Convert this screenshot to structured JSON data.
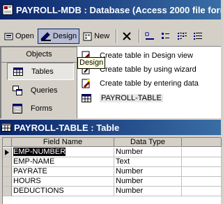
{
  "db_window": {
    "title": "PAYROLL-MDB : Database (Access 2000 file form",
    "toolbar": {
      "open": "Open",
      "design": "Design",
      "new": "New"
    },
    "objects_header": "Objects",
    "objects": [
      "Tables",
      "Queries",
      "Forms"
    ],
    "items": [
      "Create table in Design view",
      "Create table by using wizard",
      "Create table by entering data",
      "PAYROLL-TABLE"
    ],
    "tooltip": "Design"
  },
  "table_window": {
    "title": "PAYROLL-TABLE : Table",
    "columns": [
      "Field Name",
      "Data Type",
      ""
    ],
    "rows": [
      {
        "field": "EMP-NUMBER",
        "type": "Number"
      },
      {
        "field": "EMP-NAME",
        "type": "Text"
      },
      {
        "field": "PAYRATE",
        "type": "Number"
      },
      {
        "field": "HOURS",
        "type": "Number"
      },
      {
        "field": "DEDUCTIONS",
        "type": "Number"
      }
    ]
  },
  "colors": {
    "titlebar_start": "#0a246a",
    "titlebar_end": "#3a6ea5",
    "window_face": "#d4d0c8",
    "tooltip_bg": "#ffffe1"
  }
}
